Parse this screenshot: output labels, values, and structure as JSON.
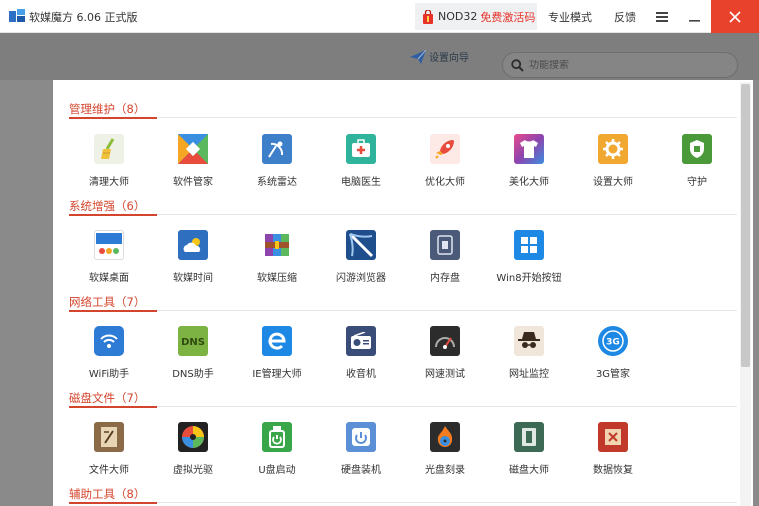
{
  "app": {
    "title": "软媒魔方 6.06 正式版"
  },
  "titlebar": {
    "nod_label": "NOD32",
    "promo_label": "免费激活码",
    "mode_label": "专业模式",
    "feedback_label": "反馈",
    "close_color": "#e8412c"
  },
  "toolbar": {
    "setup_label": "设置向导",
    "search_placeholder": "功能搜索"
  },
  "colors": {
    "section_accent": "#d4452d"
  },
  "sections": [
    {
      "title": "管理维护（8）",
      "items": [
        {
          "label": "清理大师",
          "icon": "broom-icon"
        },
        {
          "label": "软件管家",
          "icon": "box-icon"
        },
        {
          "label": "系统雷达",
          "icon": "radar-icon"
        },
        {
          "label": "电脑医生",
          "icon": "medkit-icon"
        },
        {
          "label": "优化大师",
          "icon": "rocket-icon"
        },
        {
          "label": "美化大师",
          "icon": "tshirt-icon"
        },
        {
          "label": "设置大师",
          "icon": "gear-icon"
        },
        {
          "label": "守护",
          "icon": "shield-icon"
        }
      ]
    },
    {
      "title": "系统增强（6）",
      "items": [
        {
          "label": "软媒桌面",
          "icon": "desktop-icon"
        },
        {
          "label": "软媒时间",
          "icon": "weather-icon"
        },
        {
          "label": "软媒压缩",
          "icon": "archive-icon"
        },
        {
          "label": "闪游浏览器",
          "icon": "browser-icon"
        },
        {
          "label": "内存盘",
          "icon": "chip-icon"
        },
        {
          "label": "Win8开始按钮",
          "icon": "windows-icon"
        }
      ]
    },
    {
      "title": "网络工具（7）",
      "items": [
        {
          "label": "WiFi助手",
          "icon": "wifi-icon"
        },
        {
          "label": "DNS助手",
          "icon": "dns-icon"
        },
        {
          "label": "IE管理大师",
          "icon": "ie-icon"
        },
        {
          "label": "收音机",
          "icon": "radio-icon"
        },
        {
          "label": "网速测试",
          "icon": "speedometer-icon"
        },
        {
          "label": "网址监控",
          "icon": "spy-icon"
        },
        {
          "label": "3G管家",
          "icon": "3g-icon"
        }
      ]
    },
    {
      "title": "磁盘文件（7）",
      "items": [
        {
          "label": "文件大师",
          "icon": "file-icon"
        },
        {
          "label": "虚拟光驱",
          "icon": "disc-icon"
        },
        {
          "label": "U盘启动",
          "icon": "usb-icon"
        },
        {
          "label": "硬盘装机",
          "icon": "harddisk-icon"
        },
        {
          "label": "光盘刻录",
          "icon": "burn-icon"
        },
        {
          "label": "磁盘大师",
          "icon": "diskmaster-icon"
        },
        {
          "label": "数据恢复",
          "icon": "recover-icon"
        }
      ]
    },
    {
      "title": "辅助工具（8）",
      "items": []
    }
  ]
}
